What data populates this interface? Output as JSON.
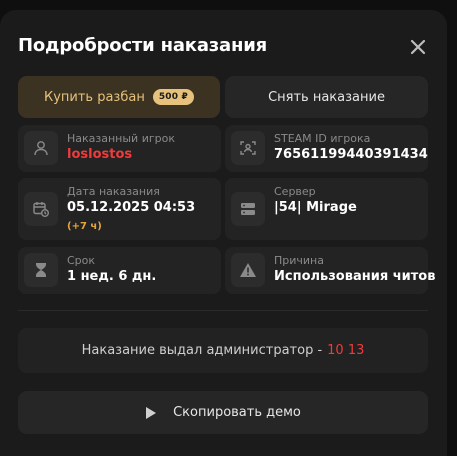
{
  "modal": {
    "title": "Подробрости наказания"
  },
  "actions": {
    "buy_label": "Купить разбан",
    "buy_price": "500 ₽",
    "remove_label": "Снять наказание"
  },
  "fields": {
    "player": {
      "label": "Наказанный игрок",
      "value": "loslostos",
      "icon": "user-icon"
    },
    "steam": {
      "label": "STEAM ID игрока",
      "value": "76561199440391434",
      "icon": "face-scan-icon"
    },
    "date": {
      "label": "Дата наказания",
      "value": "05.12.2025 04:53",
      "extra": "(+7 ч)",
      "icon": "calendar-clock-icon"
    },
    "server": {
      "label": "Сервер",
      "value": "|54| Mirage",
      "icon": "server-icon"
    },
    "term": {
      "label": "Срок",
      "value": "1 нед. 6 дн.",
      "icon": "hourglass-icon"
    },
    "reason": {
      "label": "Причина",
      "value": "Использования читов",
      "icon": "warning-icon"
    }
  },
  "admin_info": {
    "text": "Наказание выдал администратор -",
    "admin": "10 13"
  },
  "copy_demo": {
    "label": "Скопировать демо",
    "icon": "play-icon"
  },
  "colors": {
    "accent_gold": "#e7c27c",
    "danger_red": "#ef3b3b",
    "timezone_orange": "#e4a53a"
  }
}
